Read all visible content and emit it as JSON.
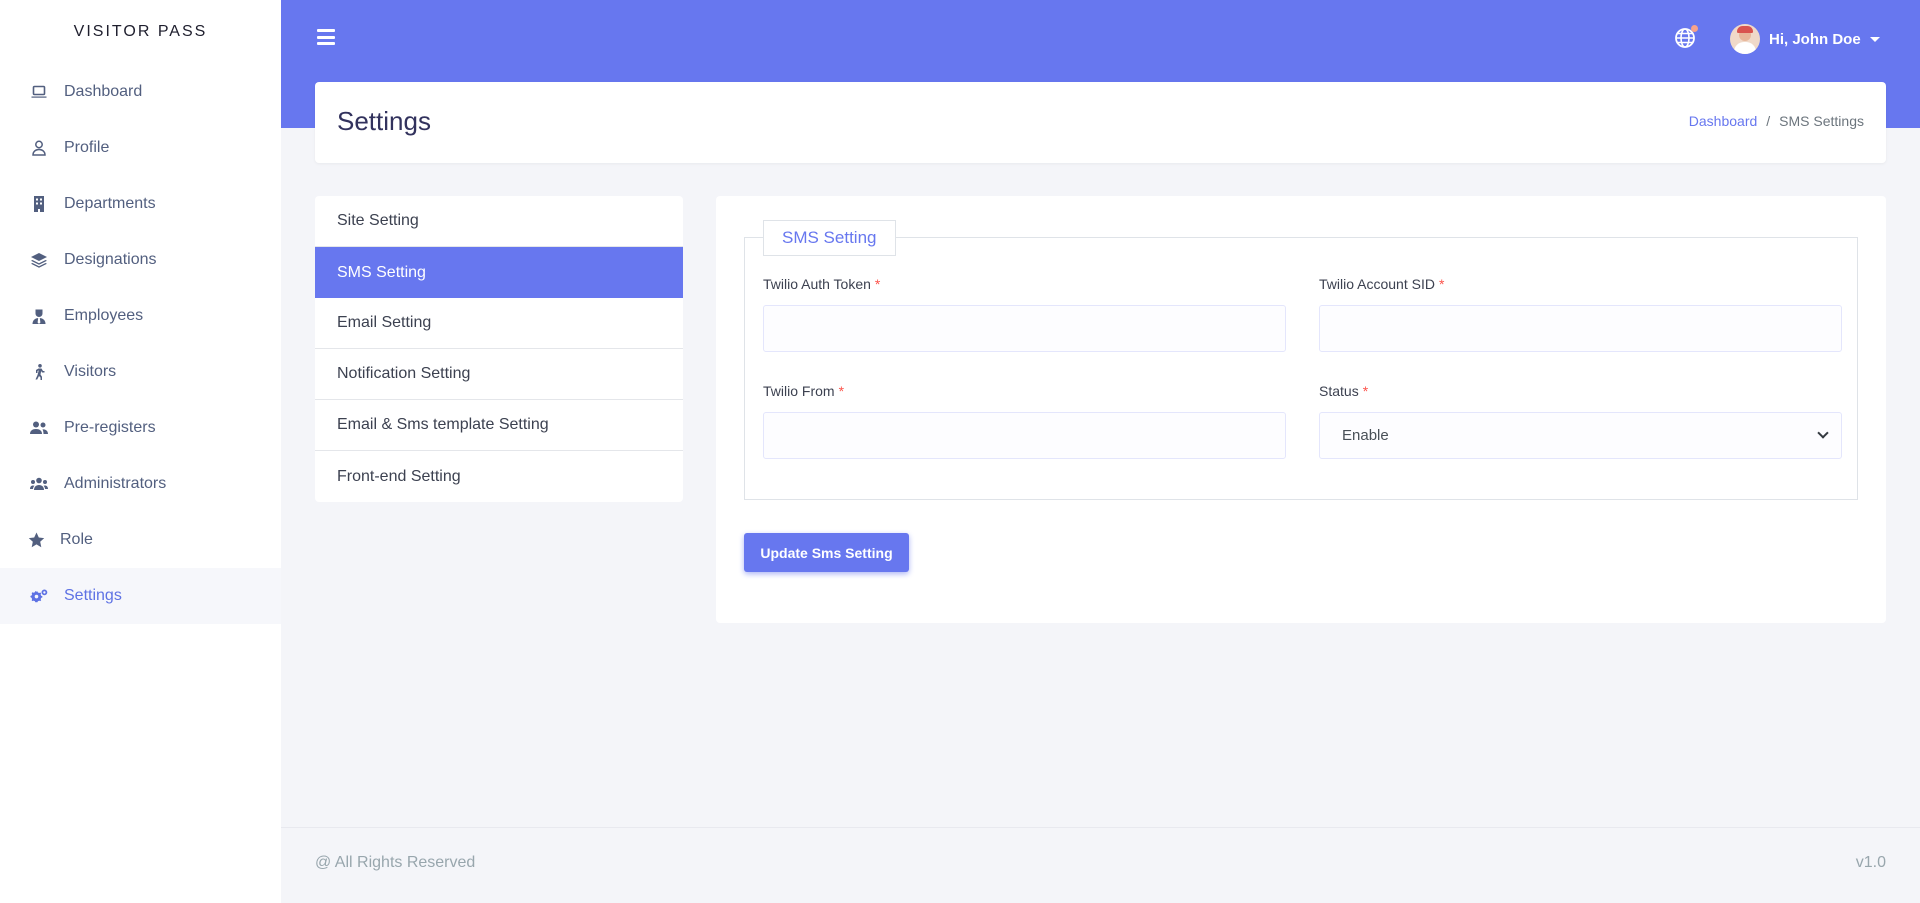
{
  "brand": {
    "title": "VISITOR PASS"
  },
  "sidebar": {
    "items": [
      {
        "label": "Dashboard",
        "icon": "laptop-icon"
      },
      {
        "label": "Profile",
        "icon": "user-icon"
      },
      {
        "label": "Departments",
        "icon": "building-icon"
      },
      {
        "label": "Designations",
        "icon": "layers-icon"
      },
      {
        "label": "Employees",
        "icon": "user-tie-icon"
      },
      {
        "label": "Visitors",
        "icon": "walking-icon"
      },
      {
        "label": "Pre-registers",
        "icon": "users-icon"
      },
      {
        "label": "Administrators",
        "icon": "users-group-icon"
      },
      {
        "label": "Role",
        "icon": "star-icon"
      },
      {
        "label": "Settings",
        "icon": "cogs-icon",
        "active": true
      }
    ]
  },
  "header": {
    "user_greeting": "Hi, John Doe",
    "accent_color": "#6777ef"
  },
  "page": {
    "title": "Settings",
    "breadcrumb": {
      "home": "Dashboard",
      "separator": "/",
      "current": "SMS Settings"
    }
  },
  "settings_menu": {
    "items": [
      {
        "label": "Site Setting"
      },
      {
        "label": "SMS Setting",
        "active": true
      },
      {
        "label": "Email Setting"
      },
      {
        "label": "Notification Setting"
      },
      {
        "label": "Email & Sms template Setting"
      },
      {
        "label": "Front-end Setting"
      }
    ]
  },
  "form": {
    "legend": "SMS Setting",
    "fields": {
      "auth_token": {
        "label": "Twilio Auth Token",
        "required_mark": "*",
        "value": ""
      },
      "account_sid": {
        "label": "Twilio Account SID",
        "required_mark": "*",
        "value": ""
      },
      "from": {
        "label": "Twilio From",
        "required_mark": "*",
        "value": ""
      },
      "status": {
        "label": "Status",
        "required_mark": "*",
        "value": "Enable"
      }
    },
    "submit_label": "Update Sms Setting"
  },
  "footer": {
    "copyright": "@ All Rights Reserved",
    "version": "v1.0"
  }
}
